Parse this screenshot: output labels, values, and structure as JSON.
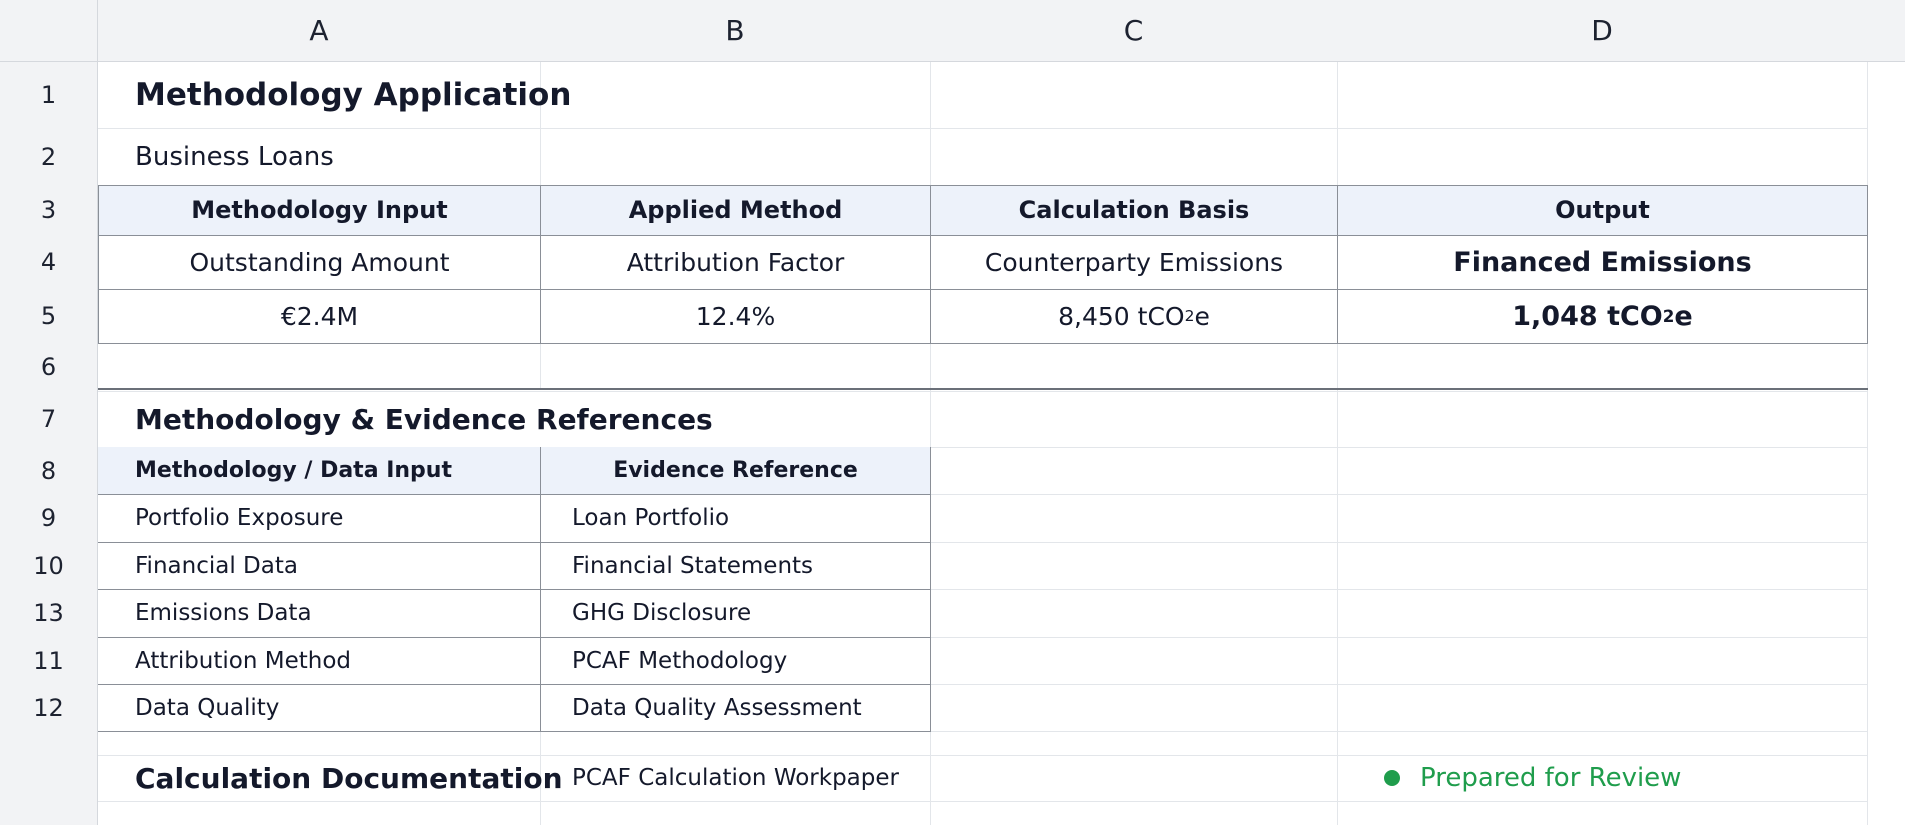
{
  "columns": [
    "A",
    "B",
    "C",
    "D"
  ],
  "rows": [
    "1",
    "2",
    "3",
    "4",
    "5",
    "6",
    "7",
    "8",
    "9",
    "10",
    "13",
    "11",
    "12",
    "",
    ""
  ],
  "section1": {
    "title": "Methodology Application",
    "subtitle": "Business Loans",
    "headers": [
      "Methodology Input",
      "Applied Method",
      "Calculation Basis",
      "Output"
    ],
    "labels": [
      "Outstanding Amount",
      "Attribution Factor",
      "Counterparty Emissions",
      "Financed Emissions"
    ],
    "values": {
      "amount": "€2.4M",
      "factor": "12.4%",
      "counterparty_prefix": "8,450 tCO",
      "counterparty_sub": "2",
      "counterparty_suffix": "e",
      "financed_prefix": "1,048 tCO",
      "financed_sub": "2",
      "financed_suffix": "e"
    }
  },
  "section2": {
    "title": "Methodology & Evidence References",
    "headers": [
      "Methodology / Data Input",
      "Evidence Reference"
    ],
    "rows": [
      {
        "input": "Portfolio Exposure",
        "evidence": "Loan Portfolio"
      },
      {
        "input": "Financial Data",
        "evidence": "Financial Statements"
      },
      {
        "input": "Emissions Data",
        "evidence": "GHG Disclosure"
      },
      {
        "input": "Attribution Method",
        "evidence": "PCAF Methodology"
      },
      {
        "input": "Data Quality",
        "evidence": "Data Quality Assessment"
      }
    ]
  },
  "documentation": {
    "label": "Calculation Documentation",
    "reference": "PCAF Calculation Workpaper",
    "status": "Prepared for Review",
    "status_color": "#1f9d4c"
  }
}
